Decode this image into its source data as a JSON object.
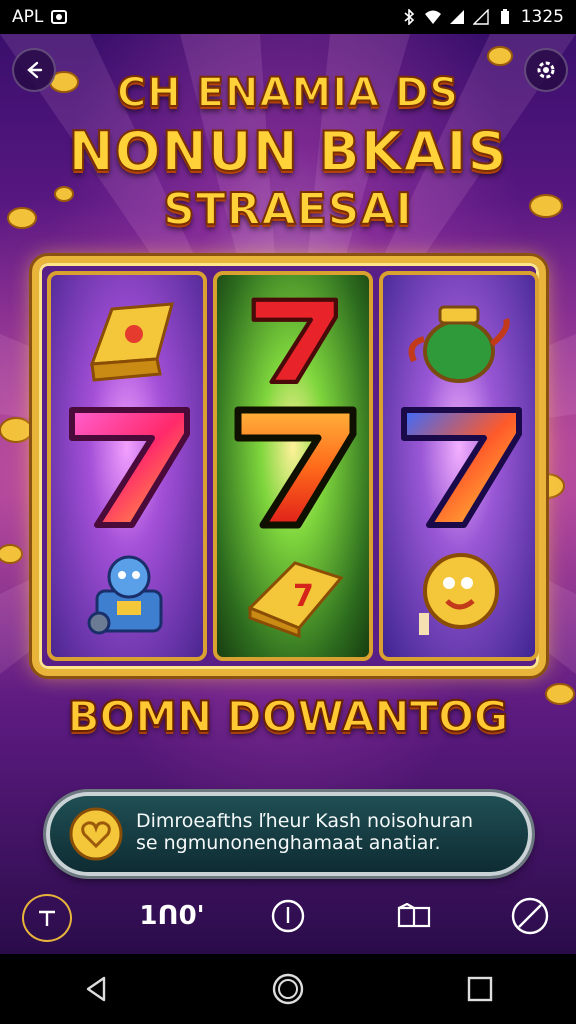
{
  "status_bar": {
    "carrier": "APL",
    "time": "1325"
  },
  "game": {
    "title_lines": [
      "CH ENAMIA DS",
      "NONUN BKAIS",
      "STRAESAI"
    ],
    "reels": [
      {
        "top": "gold-bar-icon",
        "middle": "seven-icon",
        "bottom": "robot-icon"
      },
      {
        "top": "seven-icon",
        "middle": "seven-icon",
        "bottom": "gold-bar-seven-icon"
      },
      {
        "top": "teapot-icon",
        "middle": "seven-icon",
        "bottom": "gold-coin-face-icon"
      }
    ],
    "subtitle": "BOMN DOWANTOG",
    "banner": {
      "line1": "Dimroeafths ľheur Kash noisohuran",
      "line2": "se ngmunonenghamaat anatiar."
    },
    "bottom_bar": {
      "counter": "1ᑎ0'"
    }
  },
  "colors": {
    "gold": "#e8b43a",
    "title": "#ffd23a",
    "background": "#6a1d8e",
    "banner": "#1f4f54"
  }
}
